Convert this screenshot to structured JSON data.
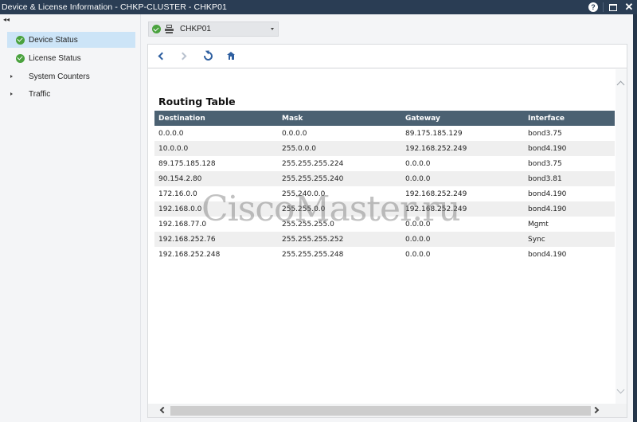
{
  "window": {
    "title": "Device & License Information - CHKP-CLUSTER - CHKP01",
    "controls": {
      "help_icon": "question-circle",
      "help_glyph": "?",
      "maximize_icon": "maximize-square",
      "close_icon": "close-x",
      "close_glyph": "✕"
    }
  },
  "sidebar": {
    "collapse_glyph": "◂◂",
    "items": [
      {
        "label": "Device Status",
        "icon": "green-check",
        "selected": true
      },
      {
        "label": "License Status",
        "icon": "green-check",
        "selected": false
      },
      {
        "label": "System Counters",
        "icon": "expand-triangle",
        "selected": false
      },
      {
        "label": "Traffic",
        "icon": "expand-triangle",
        "selected": false
      }
    ]
  },
  "device_selector": {
    "value": "CHKP01",
    "status_icon": "green-check",
    "device_icon": "gateway-icon"
  },
  "toolbar": {
    "back_icon": "chevron-left",
    "forward_icon": "chevron-right",
    "refresh_icon": "refresh",
    "home_icon": "home"
  },
  "routing_table": {
    "title": "Routing Table",
    "columns": [
      "Destination",
      "Mask",
      "Gateway",
      "Interface"
    ],
    "rows": [
      [
        "0.0.0.0",
        "0.0.0.0",
        "89.175.185.129",
        "bond3.75"
      ],
      [
        "10.0.0.0",
        "255.0.0.0",
        "192.168.252.249",
        "bond4.190"
      ],
      [
        "89.175.185.128",
        "255.255.255.224",
        "0.0.0.0",
        "bond3.75"
      ],
      [
        "90.154.2.80",
        "255.255.255.240",
        "0.0.0.0",
        "bond3.81"
      ],
      [
        "172.16.0.0",
        "255.240.0.0",
        "192.168.252.249",
        "bond4.190"
      ],
      [
        "192.168.0.0",
        "255.255.0.0",
        "192.168.252.249",
        "bond4.190"
      ],
      [
        "192.168.77.0",
        "255.255.255.0",
        "0.0.0.0",
        "Mgmt"
      ],
      [
        "192.168.252.76",
        "255.255.255.252",
        "0.0.0.0",
        "Sync"
      ],
      [
        "192.168.252.248",
        "255.255.255.248",
        "0.0.0.0",
        "bond4.190"
      ]
    ]
  },
  "watermark": "CiscoMaster.ru",
  "colors": {
    "titlebar": "#2a3d54",
    "table_header": "#4b6172",
    "selected_item": "#cce4f7",
    "status_green": "#4aa23e",
    "toolbar_icons": "#2e5fa0"
  }
}
